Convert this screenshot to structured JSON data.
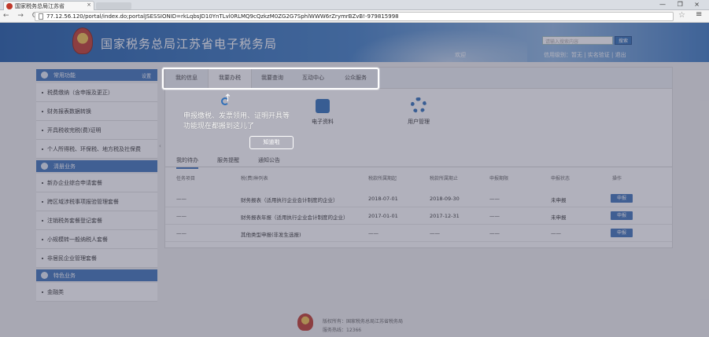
{
  "browser": {
    "tab_title": "国家税务总局江苏省",
    "tab_close": "×",
    "nav_glyphs": "← → C",
    "url": "77.12.56.120/portal/index.do;portalJSESSIONID=rkLqbsJD10YnTLvl0RLMQ9cQzkzM0ZG2G7SphlWWW6rZrymrBZvB!-979815998",
    "window_buttons": "— ❐ ×",
    "star": "☆",
    "menu": "≡"
  },
  "header": {
    "site_title": "国家税务总局江苏省电子税务局",
    "search_placeholder": "请输入搜索内容",
    "search_button": "搜索",
    "welcome": "欢迎",
    "user_links": "信用级别：暂无 | 实名验证 | 退出"
  },
  "sidebar": {
    "sections": [
      {
        "title": "常用功能",
        "more": "设置"
      },
      {
        "title": "清册业务"
      },
      {
        "title": "特色业务"
      }
    ],
    "group1": [
      "税费缴纳（含申报及更正）",
      "财务报表数据转换",
      "开具税收完税(费)证明",
      "个人所得税、环保税、地方税及社保费"
    ],
    "group2": [
      "新办企业综合申请套餐",
      "跨区域涉税事项报验管理套餐",
      "注销税务套餐登记套餐",
      "小规模转一般纳税人套餐",
      "非居民企业管理套餐"
    ],
    "group3": [
      "金融类"
    ],
    "collapse": "‹"
  },
  "main": {
    "tabs": [
      "我的信息",
      "我要办税",
      "我要查询",
      "互动中心",
      "公众服务"
    ],
    "functions": [
      "电子资料",
      "用户管理"
    ],
    "subtabs": [
      "我的待办",
      "服务提醒",
      "通知公告"
    ]
  },
  "tooltip": {
    "arrow": "↑",
    "text": "申报缴税、发票领用、证明开具等功能现在都搬到这儿了",
    "button": "知道啦"
  },
  "table": {
    "headers": [
      "任务项目",
      "税(费)种列表",
      "税款所属期起",
      "税款所属期止",
      "申报期限",
      "申报状态",
      "操作"
    ],
    "rows": [
      {
        "c0": "——",
        "c1": "财务报表（适用执行企业会计制度的企业）",
        "c2": "2018-07-01",
        "c3": "2018-09-30",
        "c4": "——",
        "c5": "未申报",
        "op": "申报"
      },
      {
        "c0": "——",
        "c1": "财务报表年报（适用执行企业会计制度的企业）",
        "c2": "2017-01-01",
        "c3": "2017-12-31",
        "c4": "——",
        "c5": "未申报",
        "op": "申报"
      },
      {
        "c0": "——",
        "c1": "其他类型申报(非发生选报)",
        "c2": "——",
        "c3": "——",
        "c4": "——",
        "c5": "——",
        "op": "申报"
      }
    ]
  },
  "footer": {
    "line1": "版权所有：国家税务总局江苏省税务局",
    "line2": "服务热线：12366"
  }
}
